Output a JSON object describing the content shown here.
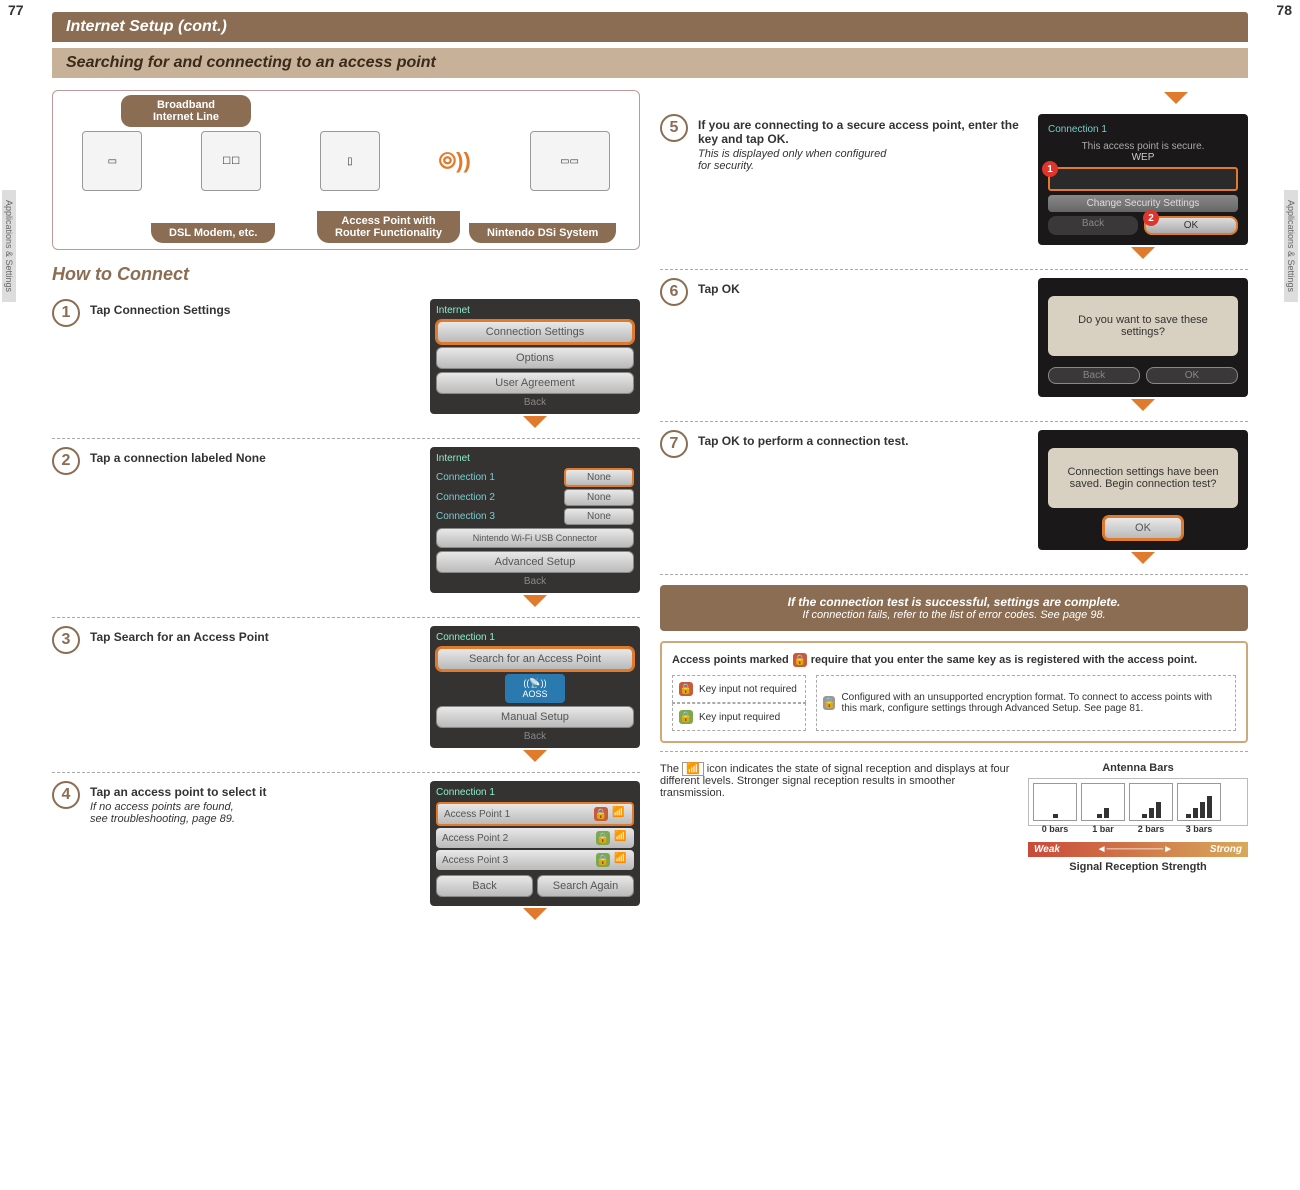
{
  "page_left": "77",
  "page_right": "78",
  "side_tab": "Applications & Settings",
  "header": "Internet Setup (cont.)",
  "subheader": "Searching for and connecting to an access point",
  "diagram": {
    "broadband": "Broadband\nInternet Line",
    "modem": "DSL Modem, etc.",
    "ap": "Access Point with\nRouter Functionality",
    "dsi": "Nintendo DSi System"
  },
  "how_to_connect": "How to Connect",
  "steps_left": [
    {
      "n": "1",
      "text": "Tap ",
      "bold": "Connection Settings",
      "screen": {
        "title": "Internet",
        "buttons": [
          "Connection Settings",
          "Options",
          "User Agreement"
        ],
        "hl": 0,
        "back": "Back"
      }
    },
    {
      "n": "2",
      "text": "Tap a connection labeled ",
      "bold": "None",
      "screen": {
        "title": "Internet",
        "conns": [
          {
            "l": "Connection 1",
            "v": "None",
            "hl": true
          },
          {
            "l": "Connection 2",
            "v": "None"
          },
          {
            "l": "Connection 3",
            "v": "None"
          }
        ],
        "extra": [
          "Nintendo Wi-Fi USB Connector",
          "Advanced Setup"
        ],
        "back": "Back"
      }
    },
    {
      "n": "3",
      "text": "Tap ",
      "bold": "Search for an Access Point",
      "screen": {
        "title": "Connection 1",
        "buttons": [
          "Search for an Access Point"
        ],
        "hl": 0,
        "aoss": "AOSS",
        "extra": [
          "Manual Setup"
        ],
        "back": "Back"
      }
    },
    {
      "n": "4",
      "text": "Tap an access point to select it",
      "sub": "If no access points are found,\nsee  troubleshooting, page 89.",
      "screen": {
        "title": "Connection 1",
        "aps": [
          {
            "n": "Access Point 1",
            "lock": "red",
            "hl": true
          },
          {
            "n": "Access Point 2",
            "lock": "green"
          },
          {
            "n": "Access Point 3",
            "lock": "green"
          }
        ],
        "dual": [
          "Back",
          "Search Again"
        ]
      }
    }
  ],
  "steps_right": [
    {
      "n": "5",
      "text": "If you are connecting to a secure access point, enter the key and tap ",
      "bold": "OK",
      "after": ".",
      "sub": "This is displayed only when configured\nfor security.",
      "screen": {
        "title": "Connection 1",
        "msg": "This access point is secure.",
        "wep": "WEP",
        "sec": "Change Security Settings",
        "back": "Back",
        "ok": "OK"
      }
    },
    {
      "n": "6",
      "text": "Tap ",
      "bold": "OK",
      "screen": {
        "msg": "Do you want to save these settings?",
        "back": "Back",
        "ok": "OK"
      }
    },
    {
      "n": "7",
      "text": "Tap ",
      "bold": "OK",
      "after": " to perform a connection test.",
      "screen": {
        "msg": "Connection settings have been saved. Begin connection test?",
        "ok": "OK"
      }
    }
  ],
  "complete": {
    "l1": "If the connection test is successful, settings are complete.",
    "l2": "If connection fails, refer to the list of error codes. See page 98."
  },
  "info": {
    "intro": "Access points marked          require that you enter the same key as is registered with the access point.",
    "key_not_req": "Key input not required",
    "key_req": "Key input required",
    "unsupported": "Configured with an unsupported encryption format. To connect to access points with this mark, configure settings through Advanced Setup. See page 81."
  },
  "signal": {
    "text": "The          icon indicates the state of signal reception and displays at four different levels. Stronger signal reception results in smoother transmission.",
    "title": "Antenna Bars",
    "bars": [
      "0 bars",
      "1 bar",
      "2 bars",
      "3 bars"
    ],
    "weak": "Weak",
    "strong": "Strong",
    "srs": "Signal Reception Strength"
  }
}
